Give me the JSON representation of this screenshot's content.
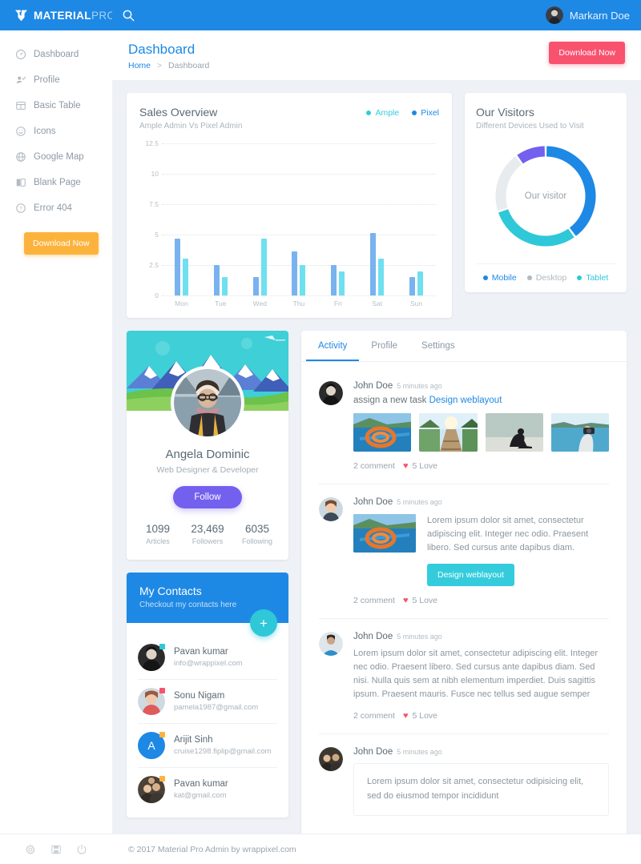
{
  "brand": {
    "name_bold": "MATERIAL",
    "name_light": "PRO"
  },
  "topbar": {
    "search_icon": "search-icon",
    "user_name": "Markarn Doe"
  },
  "sidebar": {
    "items": [
      {
        "label": "Dashboard",
        "icon": "speedometer-icon"
      },
      {
        "label": "Profile",
        "icon": "user-check-icon"
      },
      {
        "label": "Basic Table",
        "icon": "table-icon"
      },
      {
        "label": "Icons",
        "icon": "smiley-icon"
      },
      {
        "label": "Google Map",
        "icon": "globe-icon"
      },
      {
        "label": "Blank Page",
        "icon": "book-icon"
      },
      {
        "label": "Error 404",
        "icon": "question-circle-icon"
      }
    ],
    "download_label": "Download Now"
  },
  "page": {
    "title": "Dashboard",
    "breadcrumb_home": "Home",
    "breadcrumb_sep": ">",
    "breadcrumb_current": "Dashboard",
    "download_label": "Download Now"
  },
  "sales": {
    "title": "Sales Overview",
    "subtitle": "Ample Admin Vs Pixel Admin"
  },
  "visitors": {
    "title": "Our Visitors",
    "subtitle": "Different Devices Used to Visit",
    "center_label": "Our visitor"
  },
  "profile": {
    "name": "Angela Dominic",
    "role": "Web Designer & Developer",
    "follow_label": "Follow",
    "stats": [
      {
        "value": "1099",
        "label": "Articles"
      },
      {
        "value": "23,469",
        "label": "Followers"
      },
      {
        "value": "6035",
        "label": "Following"
      }
    ]
  },
  "contacts": {
    "title": "My Contacts",
    "subtitle": "Checkout my contacts here",
    "add_label": "+",
    "items": [
      {
        "name": "Pavan kumar",
        "email": "info@wrappixel.com",
        "badge_color": "#2fc8d8",
        "type": "photo"
      },
      {
        "name": "Sonu Nigam",
        "email": "pamela1987@gmail.com",
        "badge_color": "#f8526f",
        "type": "photo"
      },
      {
        "name": "Arijit Sinh",
        "email": "cruise1298.fiplip@gmail.com",
        "badge_color": "#fcb33e",
        "type": "letter",
        "letter": "A"
      },
      {
        "name": "Pavan kumar",
        "email": "kat@gmail.com",
        "badge_color": "#fcb33e",
        "type": "photo"
      }
    ]
  },
  "activity": {
    "tabs": [
      {
        "label": "Activity",
        "active": true
      },
      {
        "label": "Profile",
        "active": false
      },
      {
        "label": "Settings",
        "active": false
      }
    ],
    "posts": [
      {
        "author": "John Doe",
        "time": "5 minutes ago",
        "action_prefix": "assign a new task",
        "action_link": "Design weblayout",
        "thumbs": 4,
        "comments": "2 comment",
        "loves": "5 Love"
      },
      {
        "author": "John Doe",
        "time": "5 minutes ago",
        "text": "Lorem ipsum dolor sit amet, consectetur adipiscing elit. Integer nec odio. Praesent libero. Sed cursus ante dapibus diam.",
        "button_label": "Design weblayout",
        "comments": "2 comment",
        "loves": "5 Love"
      },
      {
        "author": "John Doe",
        "time": "5 minutes ago",
        "text": "Lorem ipsum dolor sit amet, consectetur adipiscing elit. Integer nec odio. Praesent libero. Sed cursus ante dapibus diam. Sed nisi. Nulla quis sem at nibh elementum imperdiet. Duis sagittis ipsum. Praesent mauris. Fusce nec tellus sed augue semper",
        "comments": "2 comment",
        "loves": "5 Love"
      },
      {
        "author": "John Doe",
        "time": "5 minutes ago",
        "quote": "Lorem ipsum dolor sit amet, consectetur odipisicing elit, sed do eiusmod tempor incididunt"
      }
    ]
  },
  "footer": {
    "copyright": "© 2017 Material Pro Admin by wrappixel.com",
    "icons": [
      "gear-icon",
      "save-icon",
      "power-icon"
    ]
  },
  "colors": {
    "primary": "#1e88e5",
    "cyan": "#34ccdd",
    "purple": "#7460ee",
    "pink": "#f8526f",
    "orange": "#fcb33e",
    "grey": "#e6eaee"
  },
  "chart_data": [
    {
      "type": "bar",
      "title": "Sales Overview",
      "subtitle": "Ample Admin Vs Pixel Admin",
      "categories": [
        "Mon",
        "Tue",
        "Wed",
        "Thu",
        "Fri",
        "Sat",
        "Sun"
      ],
      "series": [
        {
          "name": "Pixel",
          "color": "#78b3ef",
          "values": [
            4.7,
            2.5,
            1.5,
            3.6,
            2.5,
            5.1,
            1.5
          ]
        },
        {
          "name": "Ample",
          "color": "#6fe0ef",
          "values": [
            3.0,
            1.5,
            4.7,
            2.5,
            2.0,
            3.0,
            2.0
          ]
        }
      ],
      "ylim": [
        0,
        12.5
      ],
      "yticks": [
        0,
        2.5,
        5,
        7.5,
        10,
        12.5
      ],
      "ytick_labels": [
        "0",
        "2.5",
        "5",
        "7.5",
        "10",
        "12.5"
      ],
      "xlabel": "",
      "ylabel": "",
      "grid": true,
      "legend_position": "top-right",
      "legend": [
        "Ample",
        "Pixel"
      ]
    },
    {
      "type": "pie",
      "title": "Our Visitors",
      "subtitle": "Different Devices Used to Visit",
      "center_label": "Our visitor",
      "donut": true,
      "labels": [
        "Mobile",
        "Tablet",
        "Desktop",
        "Purple"
      ],
      "values": [
        40,
        30,
        20,
        10
      ],
      "colors": [
        "#1e88e5",
        "#2fc8d8",
        "#e8ebee",
        "#7460ee"
      ],
      "legend": [
        "Mobile",
        "Desktop",
        "Tablet"
      ],
      "legend_colors": [
        "#1e88e5",
        "#b0bac1",
        "#2fc8d8"
      ],
      "legend_position": "bottom"
    }
  ]
}
